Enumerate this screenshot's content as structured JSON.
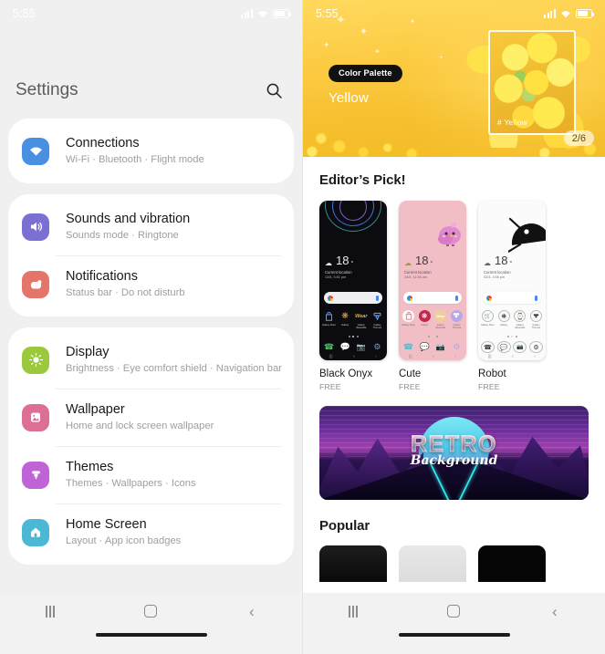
{
  "left_phone": {
    "status_bar": {
      "time": "5:55",
      "icons": [
        "signal-icon",
        "wifi-icon",
        "battery-icon"
      ]
    },
    "header": {
      "title": "Settings",
      "search_icon": "search-icon"
    },
    "groups": [
      {
        "items": [
          {
            "title": "Connections",
            "subtitle": "Wi-Fi · Bluetooth · Flight mode",
            "icon": "wifi-icon",
            "color": "#4a90e2"
          }
        ]
      },
      {
        "items": [
          {
            "title": "Sounds and vibration",
            "subtitle": "Sounds mode · Ringtone",
            "icon": "speaker-icon",
            "color": "#7b6fd4"
          },
          {
            "title": "Notifications",
            "subtitle": "Status bar · Do not disturb",
            "icon": "notification-icon",
            "color": "#e3756a"
          }
        ]
      },
      {
        "items": [
          {
            "title": "Display",
            "subtitle": "Brightness · Eye comfort shield · Navigation bar",
            "icon": "brightness-icon",
            "color": "#9ac93c"
          },
          {
            "title": "Wallpaper",
            "subtitle": "Home and lock screen wallpaper",
            "icon": "image-icon",
            "color": "#dd6e96"
          },
          {
            "title": "Themes",
            "subtitle": "Themes · Wallpapers · Icons",
            "icon": "brush-icon",
            "color": "#bf63d6"
          },
          {
            "title": "Home Screen",
            "subtitle": "Layout · App icon badges",
            "icon": "home-icon",
            "color": "#4cb8d6"
          }
        ]
      }
    ],
    "navbar": {
      "recent": "recent-apps-icon",
      "home": "home-button-icon",
      "back": "back-button-icon"
    }
  },
  "right_phone": {
    "status_bar": {
      "time": "5:55"
    },
    "hero": {
      "badge": "Color Palette",
      "color_name": "Yellow",
      "image_tag": "# Yellow",
      "page_indicator": "2/6"
    },
    "editors_pick": {
      "title": "Editor’s Pick!",
      "themes": [
        {
          "name": "Black Onyx",
          "price": "FREE",
          "style": "dark",
          "temp": "18",
          "degree": "°",
          "location": "Current location",
          "datetime": "13/5, 5:51 pm",
          "apps": [
            "Galaxy Store",
            "Galaxy",
            "Galaxy Wearable",
            "Galaxy Themes"
          ]
        },
        {
          "name": "Cute",
          "price": "FREE",
          "style": "pink",
          "temp": "18",
          "degree": "°",
          "location": "Current location",
          "datetime": "24/5, 11:56 am",
          "apps": [
            "Galaxy Store",
            "Galaxy",
            "Galaxy Wearable",
            "Galaxy Themes"
          ]
        },
        {
          "name": "Robot",
          "price": "FREE",
          "style": "white",
          "temp": "18",
          "degree": "°",
          "location": "Current location",
          "datetime": "52/3, 3:56 pm",
          "apps": [
            "Galaxy Store",
            "Galaxy",
            "Galaxy Wearable",
            "Galaxy Themes"
          ]
        }
      ]
    },
    "promo_banner": {
      "title": "RETRO",
      "subtitle": "Background"
    },
    "popular": {
      "title": "Popular"
    },
    "navbar": {
      "recent": "recent-apps-icon",
      "home": "home-button-icon",
      "back": "back-button-icon"
    }
  }
}
